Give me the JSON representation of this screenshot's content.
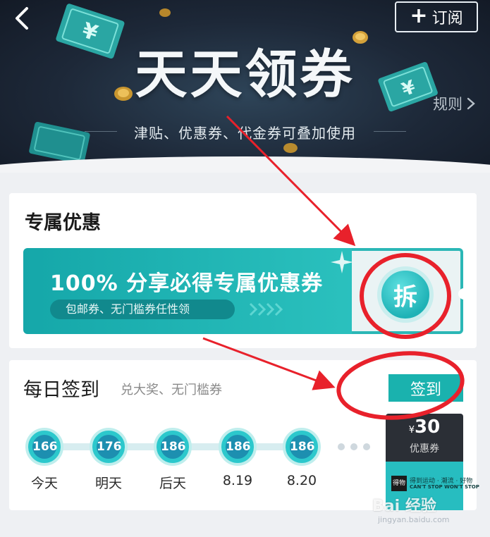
{
  "header": {
    "back_icon": "chevron-left-icon",
    "subscribe_label": "订阅",
    "subscribe_icon": "plus-icon"
  },
  "banner": {
    "title": "天天领券",
    "subtitle": "津贴、优惠券、代金券可叠加使用",
    "rules_label": "规则",
    "rules_icon": "chevron-right-icon",
    "currency_symbol": "¥"
  },
  "exclusive": {
    "title": "专属优惠",
    "coupon_main": "100% 分享必得专属优惠券",
    "coupon_sub": "包邮券、无门槛券任性领",
    "open_label": "拆"
  },
  "checkin": {
    "title": "每日签到",
    "subtitle": "兑大奖、无门槛券",
    "button_label": "签到",
    "days": [
      {
        "points": "166",
        "label": "今天"
      },
      {
        "points": "176",
        "label": "明天"
      },
      {
        "points": "186",
        "label": "后天"
      },
      {
        "points": "186",
        "label": "8.19"
      },
      {
        "points": "186",
        "label": "8.20"
      }
    ],
    "prize": {
      "currency": "¥",
      "amount": "30",
      "type": "优惠券",
      "logo_text": "得物",
      "tagline": "得到运动 · 潮流 · 好物",
      "tagline_en": "CAN'T STOP WON'T STOP"
    }
  },
  "watermark": {
    "text": "Bai 经验",
    "url": "jingyan.baidu.com"
  },
  "colors": {
    "accent": "#1ab2ae",
    "banner_dark": "#1d2838",
    "annotation_red": "#e8212b"
  }
}
